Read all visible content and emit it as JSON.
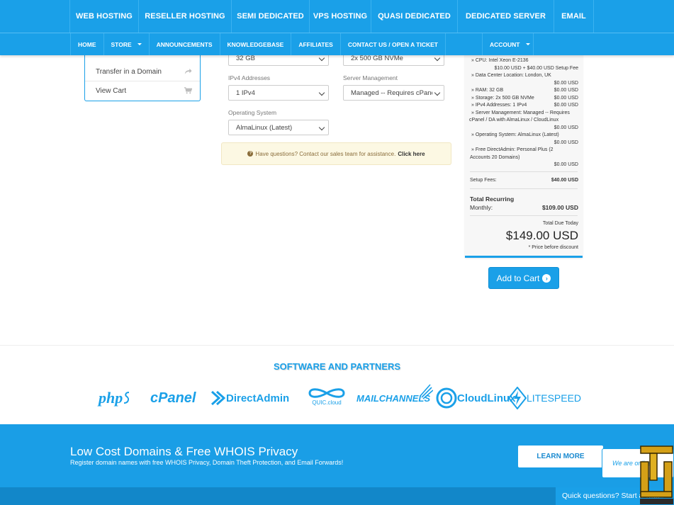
{
  "topnav": [
    "WEB HOSTING",
    "RESELLER HOSTING",
    "SEMI DEDICATED",
    "VPS HOSTING",
    "QUASI DEDICATED",
    "DEDICATED SERVER",
    "EMAIL"
  ],
  "subnav": {
    "items": [
      "HOME",
      "STORE",
      "ANNOUNCEMENTS",
      "KNOWLEDGEBASE",
      "AFFILIATES",
      "CONTACT US / OPEN A TICKET"
    ],
    "account": "ACCOUNT"
  },
  "sidebar": {
    "items": [
      {
        "label": "Transfer in a Domain",
        "icon": "share-arrow-icon"
      },
      {
        "label": "View Cart",
        "icon": "cart-icon"
      }
    ]
  },
  "config": {
    "ram_value": "32 GB",
    "storage_value": "2x 500 GB NVMe",
    "ipv4_label": "IPv4 Addresses",
    "ipv4_value": "1 IPv4",
    "mgmt_label": "Server Management",
    "mgmt_value": "Managed -- Requires cPanel",
    "os_label": "Operating System",
    "os_value": "AlmaLinux (Latest)"
  },
  "notice": {
    "text": "Have questions? Contact our sales team for assistance.",
    "link": "Click here"
  },
  "summary": {
    "lines": [
      {
        "text": "» CPU: Intel Xeon E-2136",
        "amount": ""
      },
      {
        "text": "$10.00 USD + $40.00 USD Setup Fee",
        "amount": "",
        "right": true
      },
      {
        "text": "» Data Center Location: London, UK",
        "amount": ""
      },
      {
        "text": "",
        "amount": "$0.00 USD"
      },
      {
        "text": "» RAM: 32 GB",
        "amount": "$0.00 USD"
      },
      {
        "text": "» Storage: 2x 500 GB NVMe",
        "amount": "$0.00 USD"
      },
      {
        "text": "» IPv4 Addresses: 1 IPv4",
        "amount": "$0.00 USD"
      },
      {
        "text": "» Server Management: Managed -- Requires",
        "amount": ""
      },
      {
        "text": "cPanel / DA with AlmaLinux / CloudLinux",
        "amount": ""
      },
      {
        "text": "",
        "amount": "$0.00 USD"
      },
      {
        "text": "» Operating System: AlmaLinux (Latest)",
        "amount": ""
      },
      {
        "text": "",
        "amount": "$0.00 USD"
      },
      {
        "text": "» Free DirectAdmin: Personal Plus (2",
        "amount": ""
      },
      {
        "text": "Accounts 20 Domains)",
        "amount": ""
      },
      {
        "text": "",
        "amount": "$0.00 USD"
      }
    ],
    "setup_label": "Setup Fees:",
    "setup_value": "$40.00 USD",
    "recurring_label": "Total Recurring",
    "monthly_label": "Monthly:",
    "monthly_value": "$109.00 USD",
    "due_label": "Total Due Today",
    "due_value": "$149.00 USD",
    "note": "* Price before discount"
  },
  "add_to_cart": "Add to Cart",
  "partners": {
    "title": "SOFTWARE AND PARTNERS",
    "logos": [
      "php",
      "cPanel",
      "DirectAdmin",
      "QUIC.cloud",
      "MAILCHANNELS",
      "CloudLinux",
      "LITESPEED"
    ]
  },
  "banner": {
    "title": "Low Cost Domains & Free WHOIS Privacy",
    "subtitle": "Register domain names with free WHOIS Privacy, Domain Theft Protection, and Email Forwards!",
    "button": "LEARN MORE"
  },
  "chat": {
    "bubble": "We are online!",
    "bar": "Quick questions? Start a chat"
  },
  "colors": {
    "accent": "#1aa0e8",
    "notice_bg": "#fcf8e3"
  }
}
